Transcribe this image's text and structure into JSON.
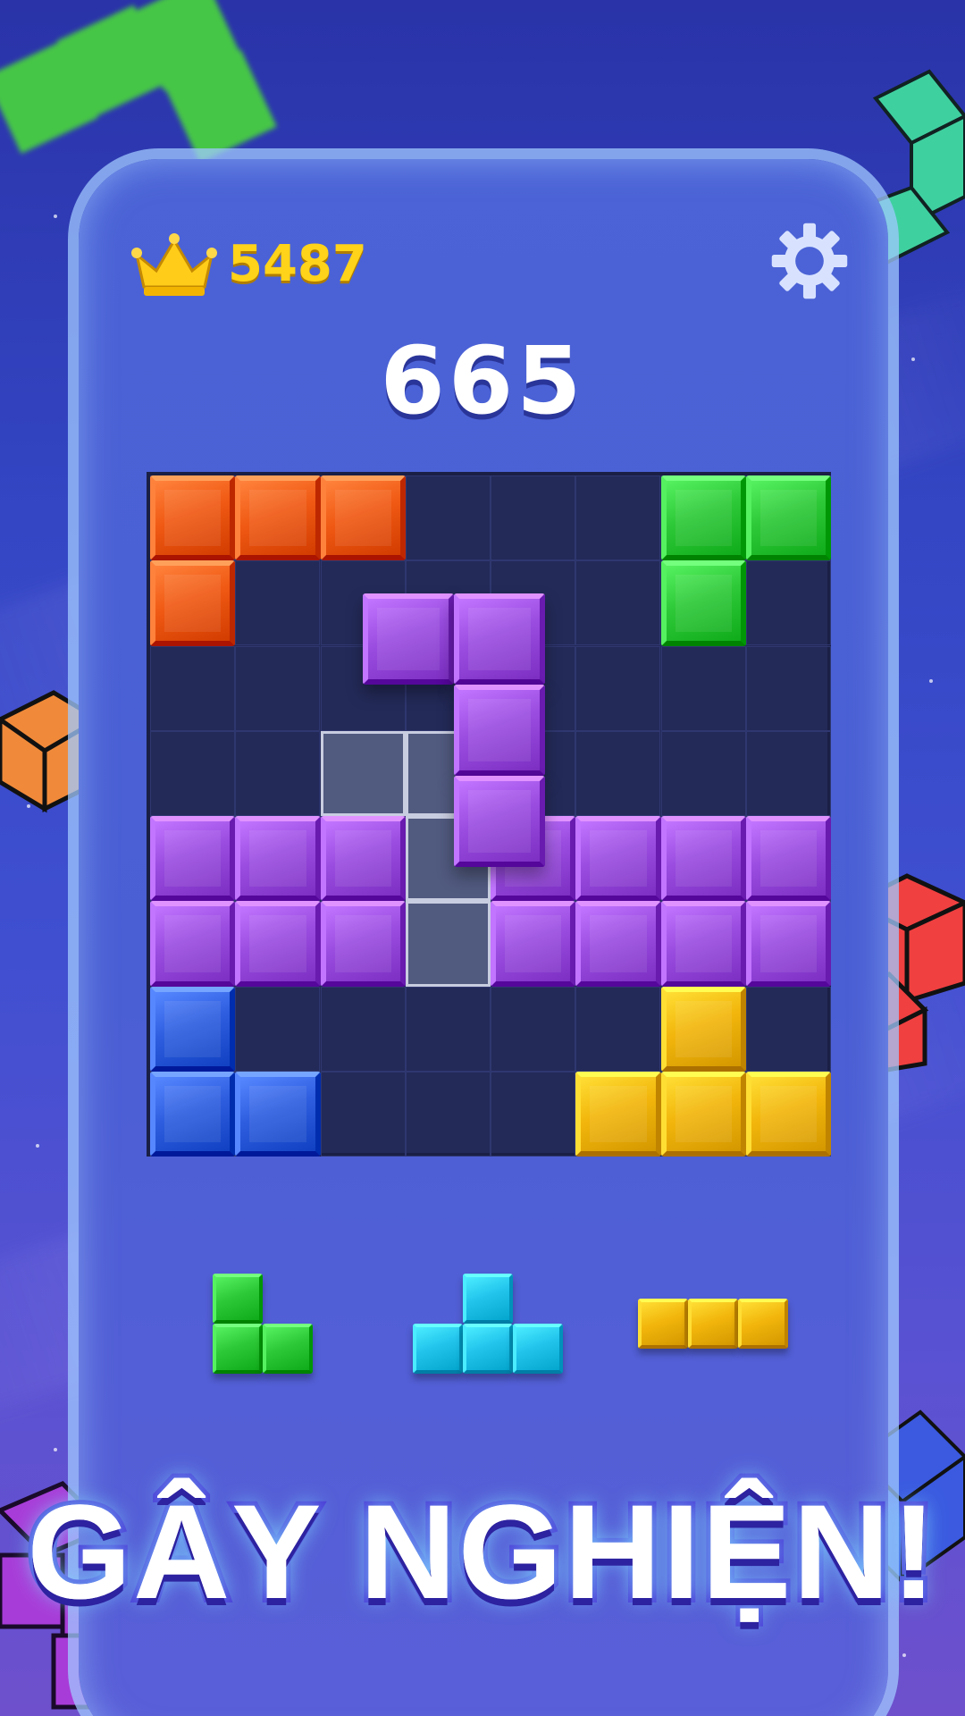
{
  "hud": {
    "best_score": "5487",
    "best_icon": "crown-icon",
    "settings_icon": "gear-icon"
  },
  "score": "665",
  "banner": "GÂY NGHIỆN!",
  "colors": {
    "orange": "#f05a14",
    "green": "#2ec938",
    "purple": "#9a4de0",
    "blue": "#2f5fe0",
    "yellow": "#f2b60c",
    "cyan": "#22c4ec",
    "empty": "#232a58"
  },
  "board": {
    "size": 8,
    "rows": [
      [
        "orange",
        "orange",
        "orange",
        "",
        "",
        "",
        "green",
        "green"
      ],
      [
        "orange",
        "",
        "",
        "",
        "",
        "",
        "green",
        ""
      ],
      [
        "",
        "",
        "",
        "",
        "",
        "",
        "",
        ""
      ],
      [
        "",
        "",
        "",
        "",
        "",
        "",
        "",
        ""
      ],
      [
        "purple",
        "purple",
        "purple",
        "",
        "purple",
        "purple",
        "purple",
        "purple"
      ],
      [
        "purple",
        "purple",
        "purple",
        "",
        "purple",
        "purple",
        "purple",
        "purple"
      ],
      [
        "blue",
        "",
        "",
        "",
        "",
        "",
        "yellow",
        ""
      ],
      [
        "blue",
        "blue",
        "",
        "",
        "",
        "yellow",
        "yellow",
        "yellow"
      ]
    ],
    "placement_preview": [
      [
        3,
        2
      ],
      [
        3,
        3
      ],
      [
        4,
        3
      ],
      [
        5,
        3
      ]
    ]
  },
  "dragged_piece": {
    "color": "purple",
    "cells": [
      [
        0,
        0
      ],
      [
        0,
        1
      ],
      [
        1,
        1
      ],
      [
        2,
        1
      ]
    ]
  },
  "tray": [
    {
      "color": "green",
      "cells": [
        [
          0,
          0
        ],
        [
          1,
          0
        ],
        [
          1,
          1
        ]
      ]
    },
    {
      "color": "cyan",
      "cells": [
        [
          0,
          1
        ],
        [
          1,
          0
        ],
        [
          1,
          1
        ],
        [
          1,
          2
        ]
      ]
    },
    {
      "color": "yellow",
      "cells": [
        [
          0,
          0
        ],
        [
          0,
          1
        ],
        [
          0,
          2
        ]
      ]
    }
  ]
}
